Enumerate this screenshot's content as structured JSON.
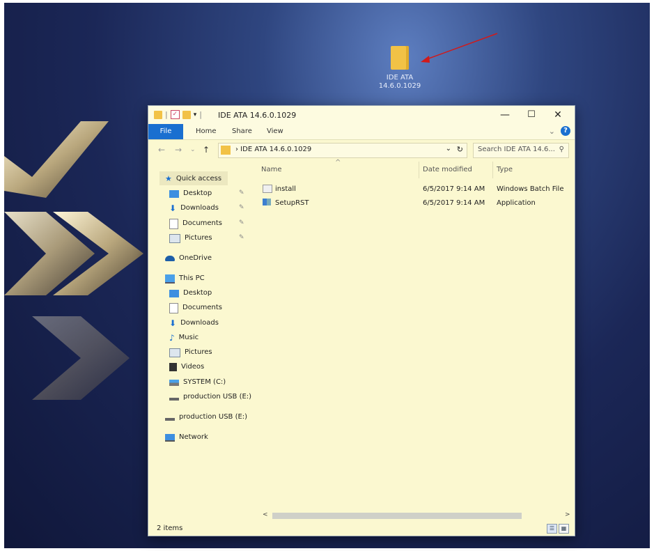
{
  "desktop": {
    "folder_label_line1": "IDE ATA",
    "folder_label_line2": "14.6.0.1029"
  },
  "titlebar": {
    "title": "IDE ATA 14.6.0.1029",
    "minimize": "—",
    "maximize": "☐",
    "close": "✕"
  },
  "ribbon": {
    "tabs": [
      "File",
      "Home",
      "Share",
      "View"
    ],
    "expand": "⌄",
    "help": "?"
  },
  "address": {
    "back": "←",
    "forward": "→",
    "recent": "⌄",
    "up": "↑",
    "path": "›  IDE ATA 14.6.0.1029",
    "dropdown": "⌄",
    "refresh": "↻",
    "search_placeholder": "Search IDE ATA 14.6...",
    "search_icon": "⚲"
  },
  "nav": {
    "quick_access": "Quick access",
    "quick_items": [
      "Desktop",
      "Downloads",
      "Documents",
      "Pictures"
    ],
    "onedrive": "OneDrive",
    "this_pc": "This PC",
    "pc_items": [
      "Desktop",
      "Documents",
      "Downloads",
      "Music",
      "Pictures",
      "Videos",
      "SYSTEM (C:)",
      "production USB (E:)"
    ],
    "usb": "production USB (E:)",
    "network": "Network"
  },
  "columns": {
    "name": "Name",
    "date": "Date modified",
    "type": "Type",
    "sort_arrow": "^"
  },
  "files": [
    {
      "name": "install",
      "date": "6/5/2017 9:14 AM",
      "type": "Windows Batch File"
    },
    {
      "name": "SetupRST",
      "date": "6/5/2017 9:14 AM",
      "type": "Application"
    }
  ],
  "scroll": {
    "left": "<",
    "right": ">"
  },
  "status": {
    "items": "2 items"
  },
  "colors": {
    "accent": "#1a6fd0",
    "folder": "#f2c246",
    "window_bg": "#fbf8d0",
    "arrow": "#d11a1a"
  },
  "icons": {
    "quick_access": "star-icon",
    "onedrive": "cloud-icon",
    "this_pc": "monitor-icon",
    "network": "network-icon"
  }
}
